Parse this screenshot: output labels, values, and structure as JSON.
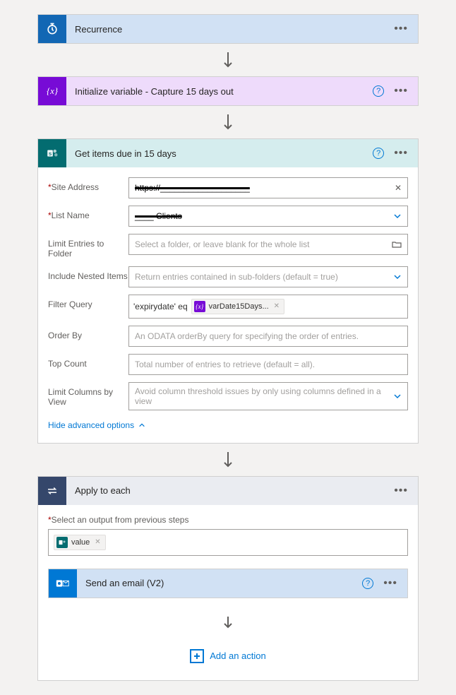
{
  "steps": {
    "recurrence": {
      "title": "Recurrence"
    },
    "initVar": {
      "title": "Initialize variable - Capture 15 days out"
    },
    "getItems": {
      "title": "Get items due in 15 days",
      "fields": {
        "siteAddress": {
          "label": "Site Address",
          "required": true,
          "value": "https://___________________"
        },
        "listName": {
          "label": "List Name",
          "required": true,
          "value": "____ Clients"
        },
        "limitFolder": {
          "label": "Limit Entries to Folder",
          "placeholder": "Select a folder, or leave blank for the whole list"
        },
        "includeNested": {
          "label": "Include Nested Items",
          "placeholder": "Return entries contained in sub-folders (default = true)"
        },
        "filterQuery": {
          "label": "Filter Query",
          "prefix": "'expirydate' eq",
          "tokenLabel": "varDate15Days..."
        },
        "orderBy": {
          "label": "Order By",
          "placeholder": "An ODATA orderBy query for specifying the order of entries."
        },
        "topCount": {
          "label": "Top Count",
          "placeholder": "Total number of entries to retrieve (default = all)."
        },
        "limitColumns": {
          "label": "Limit Columns by View",
          "placeholder": "Avoid column threshold issues by only using columns defined in a view"
        }
      },
      "advancedLink": "Hide advanced options"
    },
    "applyEach": {
      "title": "Apply to each",
      "outputLabel": "Select an output from previous steps",
      "outputToken": "value",
      "sendEmail": {
        "title": "Send an email (V2)"
      },
      "addAction": "Add an action"
    }
  }
}
